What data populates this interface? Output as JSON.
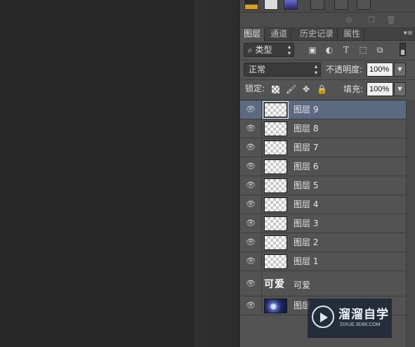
{
  "tabs": [
    {
      "label": "图层",
      "active": true
    },
    {
      "label": "通道",
      "active": false
    },
    {
      "label": "历史记录",
      "active": false
    },
    {
      "label": "属性",
      "active": false
    }
  ],
  "tabs_menu_icon": "panel-menu-icon",
  "filter": {
    "kind_label": "类型",
    "icons": [
      "image-filter-icon",
      "adjustment-filter-icon",
      "type-filter-icon",
      "shape-filter-icon",
      "smart-object-filter-icon"
    ]
  },
  "blend": {
    "mode": "正常",
    "opacity_label": "不透明度:",
    "opacity_value": "100%"
  },
  "lock": {
    "label": "锁定:",
    "icons": [
      "lock-transparent-icon",
      "lock-pixels-icon",
      "lock-position-icon",
      "lock-all-icon"
    ],
    "fill_label": "填充:",
    "fill_value": "100%"
  },
  "layers": [
    {
      "name": "图层 9",
      "type": "empty",
      "selected": true
    },
    {
      "name": "图层 8",
      "type": "empty",
      "selected": false
    },
    {
      "name": "图层 7",
      "type": "empty",
      "selected": false
    },
    {
      "name": "图层 6",
      "type": "empty",
      "selected": false
    },
    {
      "name": "图层 5",
      "type": "empty",
      "selected": false
    },
    {
      "name": "图层 4",
      "type": "empty",
      "selected": false
    },
    {
      "name": "图层 3",
      "type": "empty",
      "selected": false
    },
    {
      "name": "图层 2",
      "type": "empty",
      "selected": false
    },
    {
      "name": "图层 1",
      "type": "empty",
      "selected": false
    },
    {
      "name": "可爱",
      "type": "text",
      "thumb_text": "可爱",
      "selected": false
    },
    {
      "name": "图层",
      "type": "image",
      "selected": false
    }
  ],
  "watermark": {
    "title": "溜溜自学",
    "url": "ZIXUE.3D66.COM"
  },
  "colors": {
    "panel": "#535353",
    "selected_row": "#5b6a80",
    "canvas": "#282828"
  }
}
